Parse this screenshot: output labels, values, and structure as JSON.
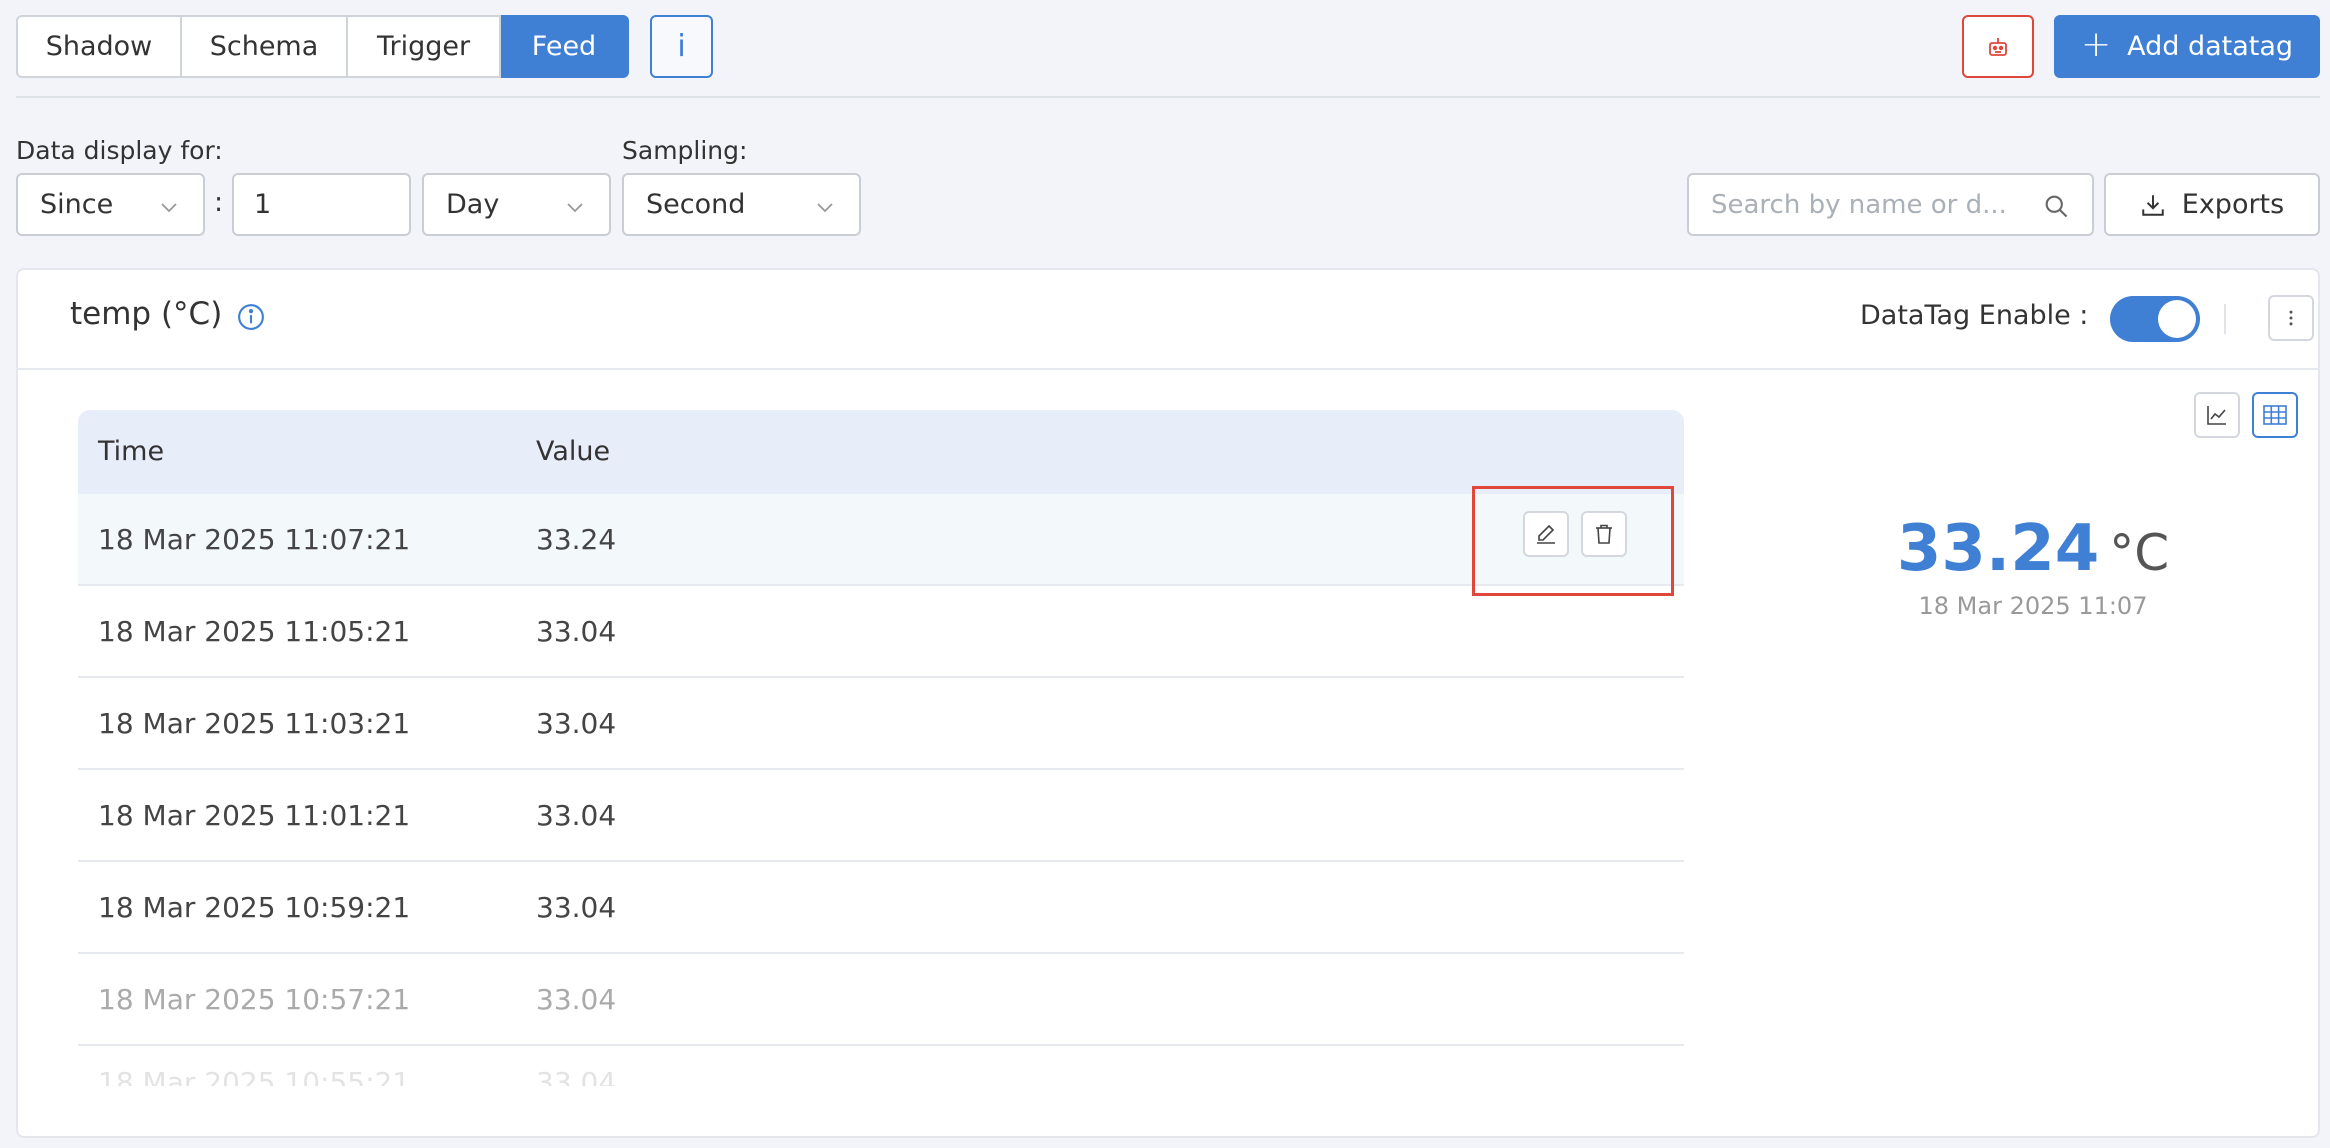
{
  "tabs": [
    "Shadow",
    "Schema",
    "Trigger",
    "Feed"
  ],
  "active_tab": "Feed",
  "info_button_label": "i",
  "add_button_label": "Add datatag",
  "filters": {
    "display_label": "Data display for:",
    "since_value": "Since",
    "colon": ":",
    "amount_value": "1",
    "unit_value": "Day",
    "sampling_label": "Sampling:",
    "sampling_value": "Second"
  },
  "search": {
    "placeholder": "Search by name or d..."
  },
  "export_label": "Exports",
  "panel": {
    "title": "temp (°C)",
    "enable_label": "DataTag Enable :",
    "enabled": true
  },
  "table": {
    "headers": [
      "Time",
      "Value"
    ],
    "rows": [
      {
        "time": "18 Mar 2025 11:07:21",
        "value": "33.24"
      },
      {
        "time": "18 Mar 2025 11:05:21",
        "value": "33.04"
      },
      {
        "time": "18 Mar 2025 11:03:21",
        "value": "33.04"
      },
      {
        "time": "18 Mar 2025 11:01:21",
        "value": "33.04"
      },
      {
        "time": "18 Mar 2025 10:59:21",
        "value": "33.04"
      },
      {
        "time": "18 Mar 2025 10:57:21",
        "value": "33.04"
      },
      {
        "time": "18 Mar 2025 10:55:21",
        "value": "33.04"
      }
    ]
  },
  "latest": {
    "value": "33.24",
    "unit": "°C",
    "time": "18 Mar 2025 11:07"
  },
  "icons": {
    "info": "info-circle-icon",
    "robot": "robot-icon",
    "search": "search-icon",
    "download": "download-icon",
    "edit": "pencil-icon",
    "delete": "trash-icon",
    "line_chart": "line-chart-icon",
    "table": "table-grid-icon",
    "kebab": "more-vertical-icon"
  },
  "colors": {
    "accent": "#3f7fd4",
    "danger": "#e0463a"
  }
}
